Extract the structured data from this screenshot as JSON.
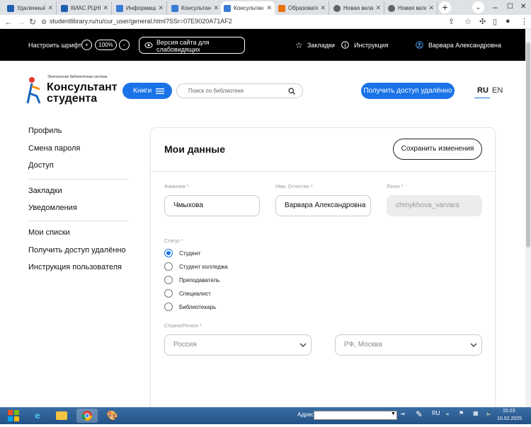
{
  "browser": {
    "tabs": [
      {
        "title": "Удаленный",
        "color": "#1f5fb0"
      },
      {
        "title": "КИАС РЦНИ",
        "color": "#1f5fb0"
      },
      {
        "title": "Информаци",
        "color": "#3a7bd5"
      },
      {
        "title": "Консультан",
        "color": "#3a7bd5"
      },
      {
        "title": "Консультан",
        "color": "#3a7bd5"
      },
      {
        "title": "Образовате",
        "color": "#e8710a"
      },
      {
        "title": "Новая вкла",
        "color": "#5f6368"
      },
      {
        "title": "Новая вкла",
        "color": "#5f6368"
      }
    ],
    "new_tab": "+",
    "url": "studentlibrary.ru/ru/cur_user/general.html?SSr=07E9020A71AF2"
  },
  "topbar": {
    "font_label": "Настроить шрифт",
    "font_plus": "+",
    "font_zoom": "100%",
    "font_minus": "-",
    "low_vision": "Версия сайта для слабовидящих",
    "bookmarks": "Закладки",
    "instruction": "Инструкция",
    "user_name": "Варвара Александровна"
  },
  "header": {
    "logo_small": "Электронная библиотечная система",
    "logo_line1": "Консультант",
    "logo_line2": "студента",
    "books_button": "Книги",
    "search_placeholder": "Поиск по библиотеке",
    "remote_access_button": "Получить доступ удалённо",
    "lang_ru": "RU",
    "lang_en": "EN"
  },
  "sidebar": {
    "items": [
      "Профиль",
      "Смена пароля",
      "Доступ",
      "Закладки",
      "Уведомления",
      "Мои списки",
      "Получить доступ удалённо",
      "Инструкция пользователя"
    ]
  },
  "main": {
    "title": "Мои данные",
    "save_button": "Сохранить изменения",
    "surname_label": "Фамилия *",
    "surname_value": "Чмыхова",
    "name_label": "Имя, Отчество *",
    "name_value": "Варвара Александровна",
    "login_label": "Логин *",
    "login_value": "chmykhova_varvara",
    "status_label": "Статус *",
    "status_options": [
      "Студент",
      "Студент колледжа",
      "Преподаватель",
      "Специалист",
      "Библиотекарь"
    ],
    "status_selected": "Студент",
    "country_label": "Страна/Регион *",
    "country_value": "Россия",
    "region_value": "РФ, Москва"
  },
  "taskbar": {
    "address_label": "Адрес",
    "lang": "RU",
    "time": "15:23",
    "date": "10.02.2025"
  }
}
